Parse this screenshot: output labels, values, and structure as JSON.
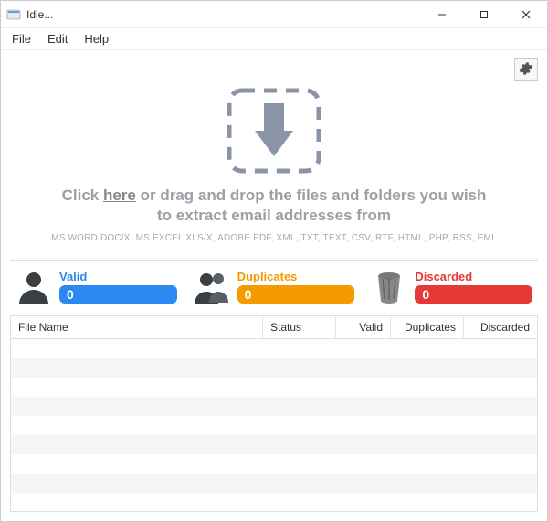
{
  "window": {
    "title": "Idle..."
  },
  "menu": {
    "file": "File",
    "edit": "Edit",
    "help": "Help"
  },
  "dropzone": {
    "prefix": "Click ",
    "link": "here",
    "middle": " or drag and drop the files and folders you wish",
    "line2": "to extract email addresses from",
    "filetypes": "MS WORD DOC/X, MS EXCEL XLS/X, ADOBE PDF, XML, TXT, TEXT, CSV, RTF, HTML, PHP, RSS, EML"
  },
  "stats": {
    "valid": {
      "label": "Valid",
      "count": "0"
    },
    "duplicates": {
      "label": "Duplicates",
      "count": "0"
    },
    "discarded": {
      "label": "Discarded",
      "count": "0"
    }
  },
  "table": {
    "headers": {
      "filename": "File Name",
      "status": "Status",
      "valid": "Valid",
      "duplicates": "Duplicates",
      "discarded": "Discarded"
    }
  }
}
